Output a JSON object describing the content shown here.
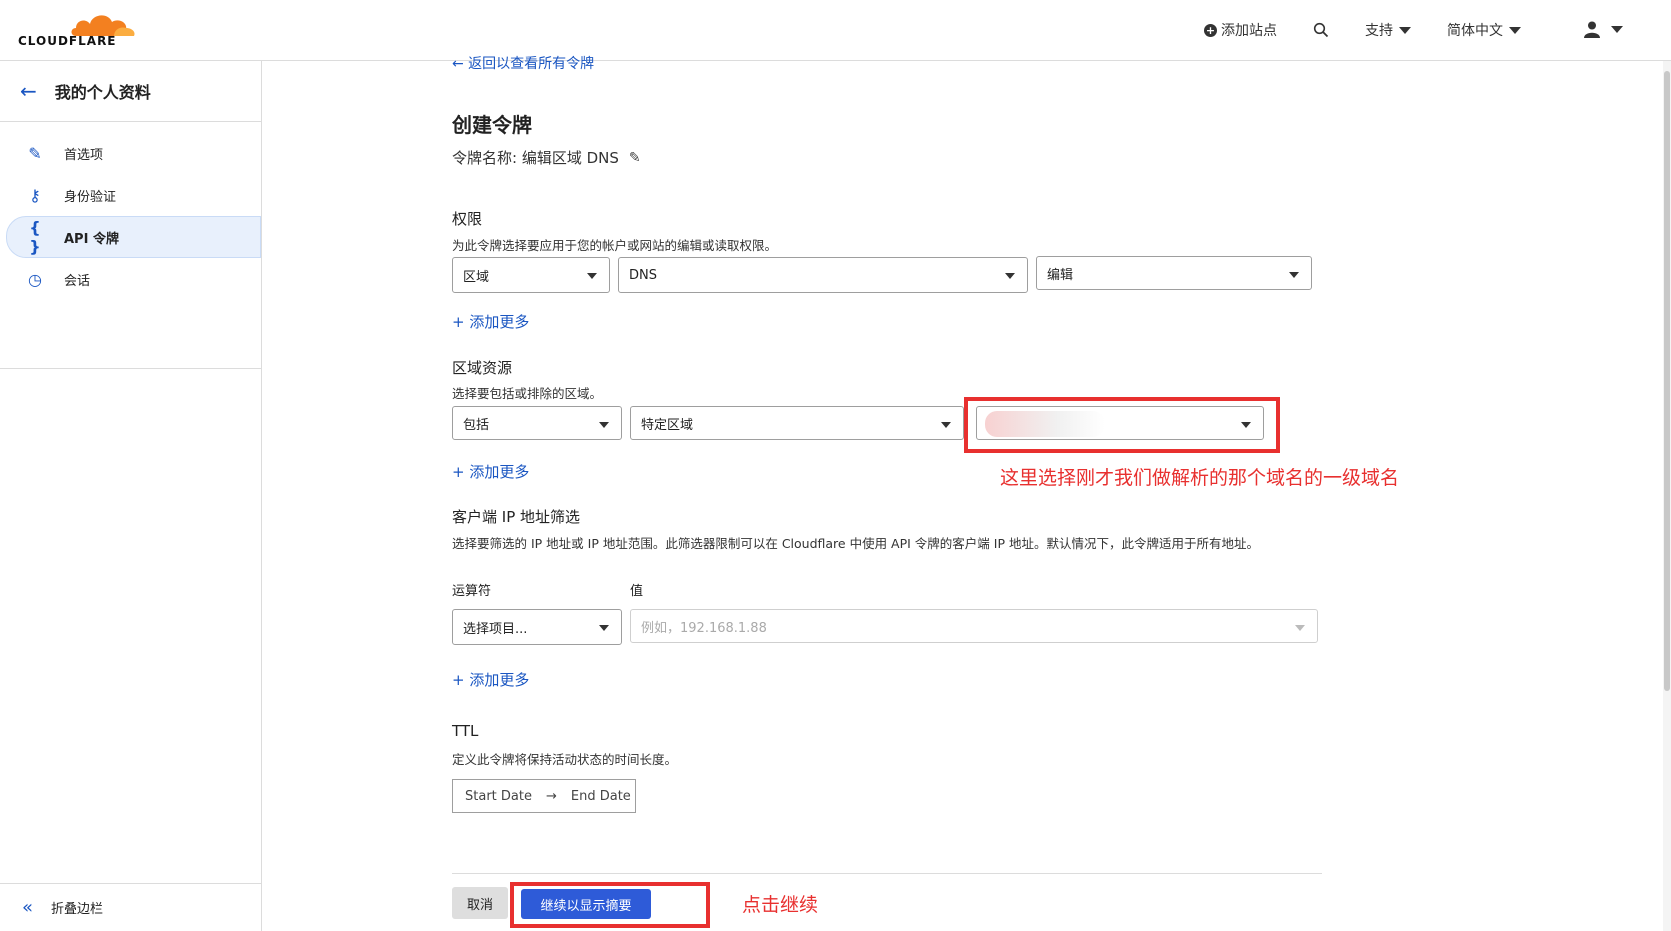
{
  "header": {
    "logo_text": "CLOUDFLARE",
    "add_site": "添加站点",
    "support": "支持",
    "language": "简体中文"
  },
  "sidebar": {
    "title": "我的个人资料",
    "items": [
      {
        "label": "首选项",
        "icon": "pencil-icon"
      },
      {
        "label": "身份验证",
        "icon": "key-icon"
      },
      {
        "label": "API 令牌",
        "icon": "braces-icon",
        "active": true
      },
      {
        "label": "会话",
        "icon": "clock-icon"
      }
    ],
    "collapse": "折叠边栏"
  },
  "main": {
    "back_link": "← 返回以查看所有令牌",
    "title": "创建令牌",
    "token_name": "令牌名称: 编辑区域 DNS",
    "permissions": {
      "title": "权限",
      "desc": "为此令牌选择要应用于您的帐户或网站的编辑或读取权限。",
      "scope": "区域",
      "resource": "DNS",
      "level": "编辑",
      "add_more": "+ 添加更多"
    },
    "zone_resources": {
      "title": "区域资源",
      "desc": "选择要包括或排除的区域。",
      "include": "包括",
      "type": "特定区域",
      "add_more": "+ 添加更多"
    },
    "ip_filter": {
      "title": "客户端 IP 地址筛选",
      "desc": "选择要筛选的 IP 地址或 IP 地址范围。此筛选器限制可以在 Cloudflare 中使用 API 令牌的客户端 IP 地址。默认情况下，此令牌适用于所有地址。",
      "operator_label": "运算符",
      "value_label": "值",
      "operator_placeholder": "选择项目...",
      "value_placeholder": "例如，192.168.1.88",
      "add_more": "+ 添加更多"
    },
    "ttl": {
      "title": "TTL",
      "desc": "定义此令牌将保持活动状态的时间长度。",
      "start": "Start Date",
      "end": "End Date"
    },
    "buttons": {
      "cancel": "取消",
      "continue": "继续以显示摘要"
    }
  },
  "annotations": {
    "zone_note": "这里选择刚才我们做解析的那个域名的一级域名",
    "continue_note": "点击继续",
    "color": "#e8302f"
  },
  "colors": {
    "accent": "#1a56c2",
    "primary_button": "#2e5bd8",
    "brand_orange": "#f38020"
  }
}
